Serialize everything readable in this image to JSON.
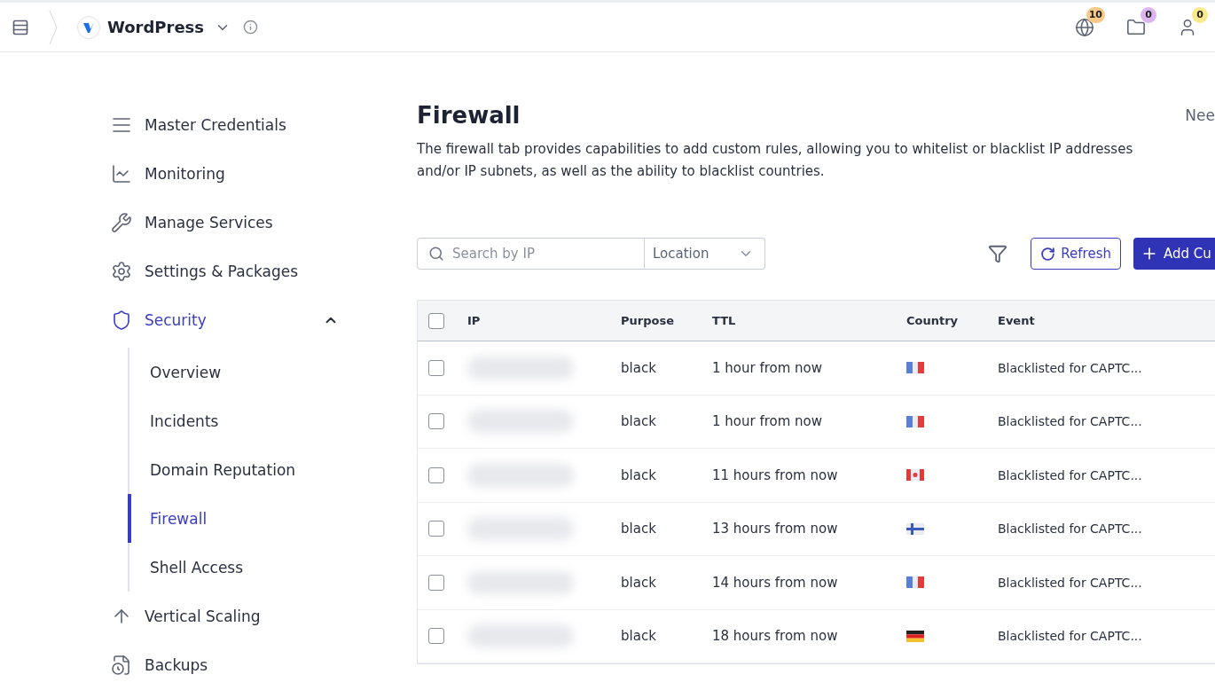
{
  "topbar": {
    "app_name": "WordPress",
    "badges": [
      {
        "kind": "domains",
        "count": "10",
        "color": "#f9c98a"
      },
      {
        "kind": "files",
        "count": "0",
        "color": "#dcb5ef"
      },
      {
        "kind": "users",
        "count": "0",
        "color": "#fbe98c"
      }
    ]
  },
  "sidebar": {
    "items": [
      {
        "label": "Master Credentials",
        "kind": "credentials",
        "selected": false
      },
      {
        "label": "Monitoring",
        "kind": "monitoring",
        "selected": false
      },
      {
        "label": "Manage Services",
        "kind": "services",
        "selected": false
      },
      {
        "label": "Settings & Packages",
        "kind": "settings",
        "selected": false
      },
      {
        "label": "Security",
        "kind": "security",
        "selected": true,
        "expanded": true,
        "children": [
          {
            "label": "Overview",
            "selected": false
          },
          {
            "label": "Incidents",
            "selected": false
          },
          {
            "label": "Domain Reputation",
            "selected": false
          },
          {
            "label": "Firewall",
            "selected": true
          },
          {
            "label": "Shell Access",
            "selected": false
          }
        ]
      },
      {
        "label": "Vertical Scaling",
        "kind": "scaling",
        "selected": false
      },
      {
        "label": "Backups",
        "kind": "backups",
        "selected": false
      }
    ]
  },
  "page": {
    "title": "Firewall",
    "help_link": "Nee",
    "description": "The firewall tab provides capabilities to add custom rules, allowing you to whitelist or blacklist IP addresses and/or IP subnets, as well as the ability to blacklist countries.",
    "search": {
      "placeholder": "Search by IP"
    },
    "location": {
      "value": "Location"
    },
    "refresh_button": "Refresh",
    "add_button": "Add Cu"
  },
  "table": {
    "select_all_checked": false,
    "columns": [
      "IP",
      "Purpose",
      "TTL",
      "Country",
      "Event"
    ],
    "rows": [
      {
        "checked": false,
        "purpose": "black",
        "ttl": "1 hour from now",
        "flag": {
          "kind": "fr"
        },
        "event": "Blacklisted for CAPTC..."
      },
      {
        "checked": false,
        "purpose": "black",
        "ttl": "1 hour from now",
        "flag": {
          "kind": "fr"
        },
        "event": "Blacklisted for CAPTC..."
      },
      {
        "checked": false,
        "purpose": "black",
        "ttl": "11 hours from now",
        "flag": {
          "kind": "ca"
        },
        "event": "Blacklisted for CAPTC..."
      },
      {
        "checked": false,
        "purpose": "black",
        "ttl": "13 hours from now",
        "flag": {
          "kind": "fi"
        },
        "event": "Blacklisted for CAPTC..."
      },
      {
        "checked": false,
        "purpose": "black",
        "ttl": "14 hours from now",
        "flag": {
          "kind": "fr"
        },
        "event": "Blacklisted for CAPTC..."
      },
      {
        "checked": false,
        "purpose": "black",
        "ttl": "18 hours from now",
        "flag": {
          "kind": "de"
        },
        "event": "Blacklisted for CAPTC..."
      }
    ]
  }
}
